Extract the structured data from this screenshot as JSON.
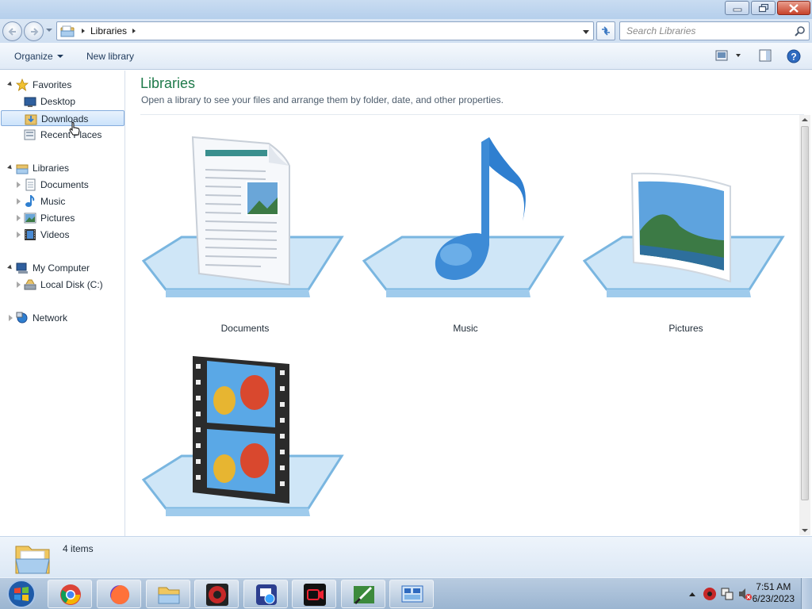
{
  "window": {
    "title": "",
    "controls": {
      "minimize": "minimize-button",
      "restore": "restore-button",
      "close": "close-button"
    }
  },
  "address": {
    "breadcrumb": "Libraries",
    "search_placeholder": "Search Libraries"
  },
  "toolbar": {
    "organize": "Organize",
    "new_library": "New library"
  },
  "sidebar": {
    "favorites": "Favorites",
    "favorite_items": [
      "Desktop",
      "Downloads",
      "Recent Places"
    ],
    "libraries": "Libraries",
    "library_items": [
      "Documents",
      "Music",
      "Pictures",
      "Videos"
    ],
    "computer": "My Computer",
    "computer_items": [
      "Local Disk (C:)"
    ],
    "network": "Network",
    "selected_item": "Downloads"
  },
  "content": {
    "title": "Libraries",
    "subtitle": "Open a library to see your files and arrange them by folder, date, and other properties.",
    "libraries": [
      "Documents",
      "Music",
      "Pictures",
      "Videos"
    ]
  },
  "status": {
    "item_count": "4 items"
  },
  "taskbar": {
    "apps": [
      "chrome-icon",
      "firefox-icon",
      "explorer-icon",
      "app-red-icon",
      "app-blue-icon",
      "recorder-icon",
      "tool-icon",
      "control-panel-icon"
    ],
    "time": "7:51 AM",
    "date": "6/23/2023"
  },
  "colors": {
    "title_green": "#1e7a4a",
    "selection_blue": "#cce3fb",
    "taskbar": "#9bb5d1"
  }
}
